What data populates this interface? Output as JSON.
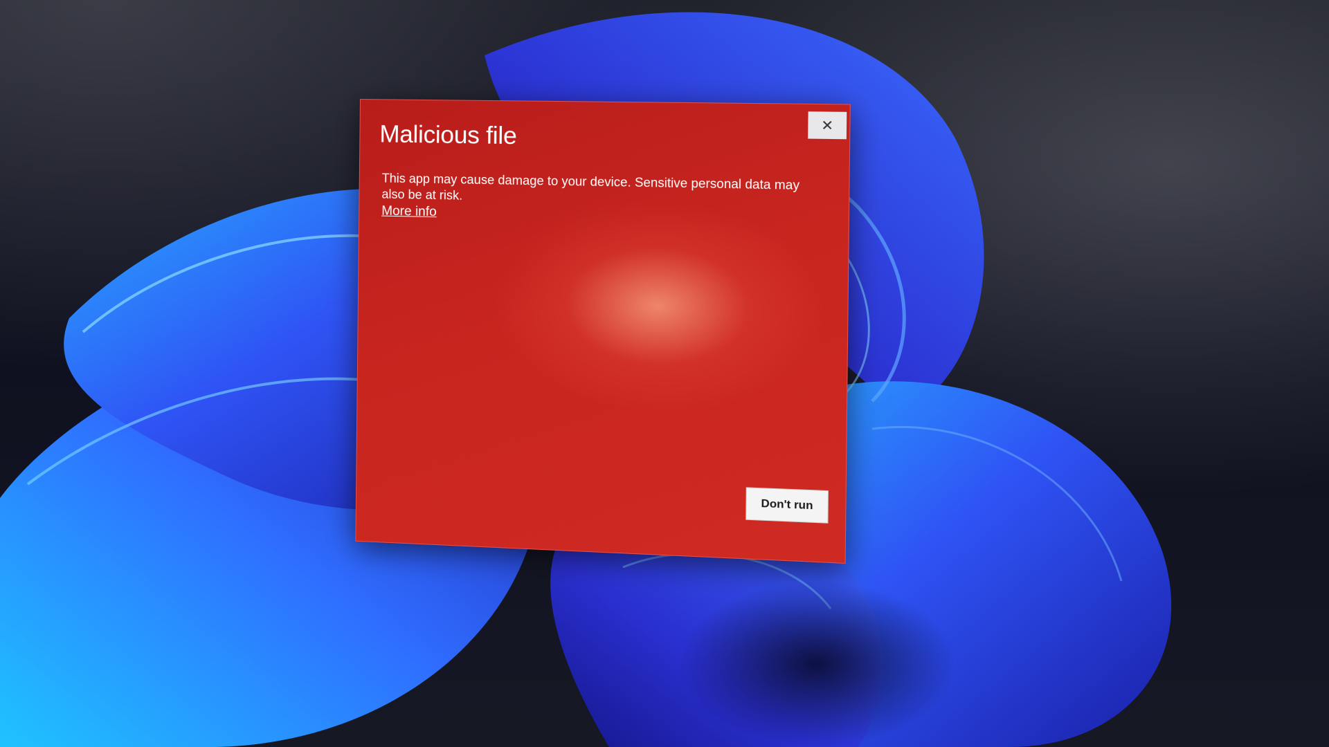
{
  "dialog": {
    "title": "Malicious file",
    "message": "This app may cause damage to your device. Sensitive personal data may also be at risk.",
    "link_label": "More info",
    "primary_button": "Don't run",
    "close_icon": "close-icon",
    "background_color": "#c8251f"
  },
  "desktop": {
    "wallpaper": "windows-bloom-wallpaper",
    "accent_color": "#3b3cff"
  }
}
